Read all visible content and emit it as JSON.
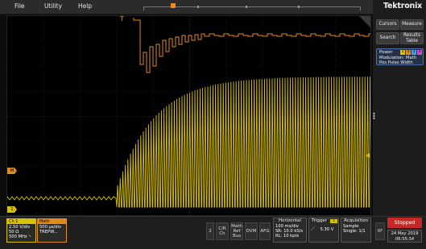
{
  "menu": {
    "file": "File",
    "utility": "Utility",
    "help": "Help"
  },
  "brand": {
    "logo": "Tektronix"
  },
  "right_panel": {
    "cursors": "Cursors",
    "measure": "Measure",
    "search": "Search",
    "results": "Results Table",
    "power": {
      "title": "Power",
      "badges": [
        "1",
        "5",
        "2",
        "3"
      ],
      "line1": "Modulation: Math",
      "line2": "Pos Pulse Width"
    }
  },
  "channels": {
    "ch1": {
      "head": "Ch 1",
      "line1": "2.50 V/div",
      "line2": "50 Ω",
      "line3": "500 MHz ␈"
    },
    "math": {
      "head": "Math",
      "line1": "500 μs/div",
      "line2": "TREPW..."
    }
  },
  "bottom_buttons": {
    "b2": "2",
    "cr": "C/R Ch",
    "mathref": "Math Ref Bus",
    "dvm": "DVM",
    "afg": "AFG"
  },
  "horizontal": {
    "title": "Horizontal",
    "line1": "100 ms/div",
    "line2": "SR: 10.0 kS/s",
    "line3": "RL: 10 kpts"
  },
  "trigger": {
    "title": "Trigger",
    "badge": "1",
    "value": "5.30 V"
  },
  "acquisition": {
    "title": "Acquisition",
    "line1": "Sample",
    "line2": "Single: 1/1"
  },
  "rf": "RF",
  "status": {
    "stopped": "Stopped",
    "date": "24 May 2019",
    "time": "06:55:34"
  },
  "markers": {
    "math": "M",
    "ch1": "1",
    "trigger": "T"
  },
  "colors": {
    "ch1": "#d9c100",
    "math": "#e08a1e",
    "stopped": "#c62828",
    "accent_blue": "#4c6ea8"
  }
}
